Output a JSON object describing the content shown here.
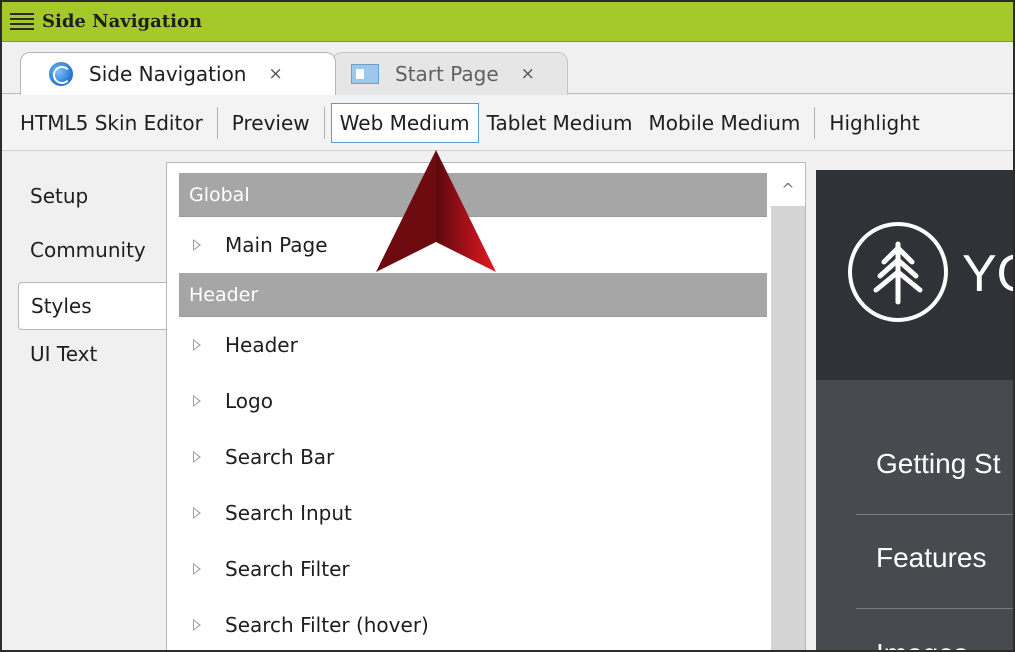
{
  "window": {
    "title": "Side Navigation"
  },
  "tabs": [
    {
      "label": "Side Navigation",
      "close": "×",
      "icon": "globe-icon",
      "active": true
    },
    {
      "label": "Start Page",
      "close": "×",
      "icon": "page-icon",
      "active": false
    }
  ],
  "toolbar": {
    "items": [
      {
        "label": "HTML5 Skin Editor"
      },
      {
        "label": "Preview"
      },
      {
        "label": "Web Medium",
        "selected": true
      },
      {
        "label": "Tablet Medium"
      },
      {
        "label": "Mobile Medium"
      },
      {
        "label": "Highlight"
      }
    ]
  },
  "leftnav": {
    "items": [
      {
        "label": "Setup"
      },
      {
        "label": "Community"
      },
      {
        "label": "Styles",
        "selected": true
      },
      {
        "label": "UI Text"
      }
    ]
  },
  "styles_list": {
    "groups": [
      {
        "header": "Global",
        "items": [
          "Main Page"
        ]
      },
      {
        "header": "Header",
        "items": [
          "Header",
          "Logo",
          "Search Bar",
          "Search Input",
          "Search Filter",
          "Search Filter (hover)"
        ]
      }
    ],
    "scroll_up_glyph": "^"
  },
  "preview": {
    "logo_text": "YO",
    "nav_items": [
      "Getting St",
      "Features",
      "Images"
    ],
    "colors": {
      "header_bg": "#2f3236",
      "body_bg": "#474b4f",
      "text": "#ffffff"
    }
  },
  "colors": {
    "titlebar": "#a5c92a",
    "selected_border": "#5b9bd5",
    "group_header": "#a6a6a6",
    "arrow": "#c8141c"
  }
}
